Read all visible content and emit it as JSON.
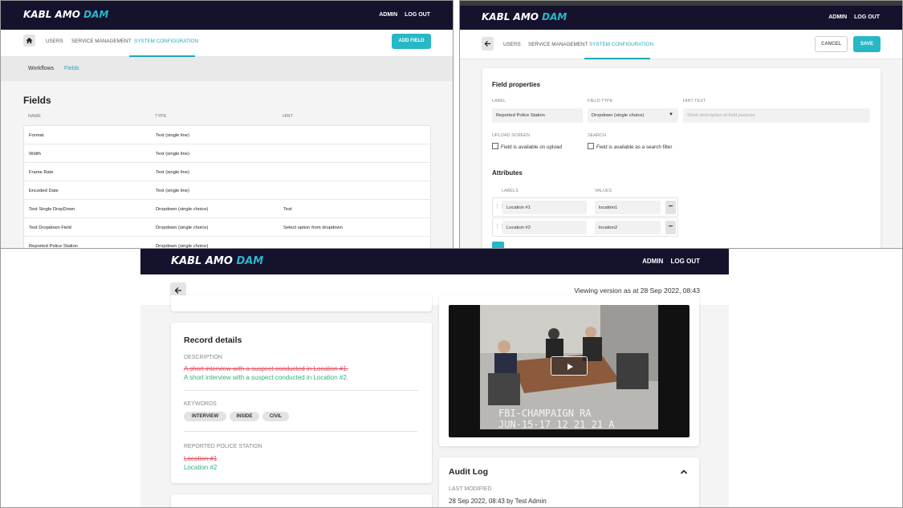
{
  "brand": {
    "name_main": "KABL AMO ",
    "name_accent": "DAM"
  },
  "toplinks": {
    "admin": "ADMIN",
    "logout": "LOG OUT"
  },
  "nav": {
    "users": "USERS",
    "service": "SERVICE MANAGEMENT",
    "system": "SYSTEM CONFIGURATION"
  },
  "fields_page": {
    "add_field": "ADD FIELD",
    "subnav": {
      "workflows": "Workflows",
      "fields": "Fields"
    },
    "title": "Fields",
    "columns": {
      "name": "NAME",
      "type": "TYPE",
      "hint": "HINT"
    },
    "rows": [
      {
        "name": "Format",
        "type": "Text (single line)",
        "hint": ""
      },
      {
        "name": "Width",
        "type": "Text (single line)",
        "hint": ""
      },
      {
        "name": "Frame Rate",
        "type": "Text (single line)",
        "hint": ""
      },
      {
        "name": "Encoded Date",
        "type": "Text (single line)",
        "hint": ""
      },
      {
        "name": "Test Single DropDown",
        "type": "Dropdown (single choice)",
        "hint": "Test"
      },
      {
        "name": "Test Dropdown Field",
        "type": "Dropdown (single choice)",
        "hint": "Select option from dropdown"
      },
      {
        "name": "Reported Police Station",
        "type": "Dropdown (single choice)",
        "hint": ""
      }
    ]
  },
  "field_editor": {
    "cancel": "CANCEL",
    "save": "SAVE",
    "properties_title": "Field properties",
    "label_label": "LABEL",
    "label_value": "Reported Police Station",
    "field_type_label": "FIELD TYPE",
    "field_type_value": "Dropdown (single choice)",
    "hint_label": "HINT TEXT",
    "hint_placeholder": "Short description of field purpose",
    "upload_label": "UPLOAD SCREEN",
    "upload_checkbox": "Field is available on upload",
    "search_label": "SEARCH",
    "search_checkbox": "Field is available as a search filter",
    "attributes_title": "Attributes",
    "labels_col": "LABELS",
    "values_col": "VALUES",
    "attributes": [
      {
        "label": "Location #1",
        "value": "location1"
      },
      {
        "label": "Location #2",
        "value": "location2"
      }
    ]
  },
  "record_view": {
    "viewing": "Viewing version as at 28 Sep 2022, 08:43",
    "record_title": "Record details",
    "description_label": "DESCRIPTION",
    "description_old": "A short interview with a suspect conducted in Location #1.",
    "description_new": "A short interview with a suspect conducted in Location #2.",
    "keywords_label": "KEYWORDS",
    "keywords": [
      "INTERVIEW",
      "INSIDE",
      "CIVIL"
    ],
    "station_label": "REPORTED POLICE STATION",
    "station_old": "Location #1",
    "station_new": "Location #2",
    "video_caption_line1": "FBI-CHAMPAIGN RA",
    "video_caption_line2": "JUN-15-17 12 21 21 A",
    "audit_title": "Audit Log",
    "last_modified_label": "LAST MODIFIED",
    "last_modified_value": "28 Sep 2022, 08:43 by Test Admin"
  },
  "colors": {
    "navy": "#15122e",
    "teal": "#27b8c8",
    "strike": "#e05264",
    "added": "#2fb37a"
  }
}
